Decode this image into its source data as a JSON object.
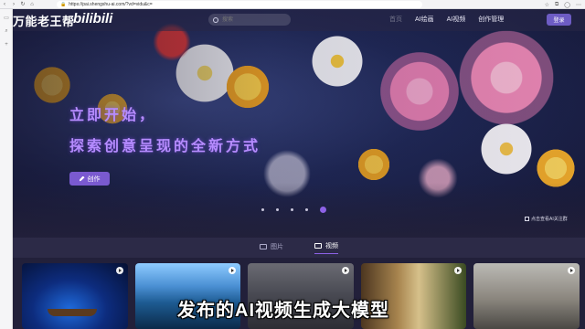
{
  "browser": {
    "url": "https://pai.shengshu-ai.com/?vd=vidu&c=",
    "nav_icons": [
      "back-icon",
      "forward-icon",
      "refresh-icon"
    ]
  },
  "header": {
    "brand_text": "万能老王帮",
    "brand_logo": "bilibili",
    "search_placeholder": "搜索",
    "nav": [
      "首页",
      "AI绘画",
      "AI视频",
      "创作管理"
    ],
    "login_label": "登录"
  },
  "hero": {
    "title": "立即开始，",
    "subtitle": "探索创意呈现的全新方式",
    "create_label": "创作",
    "slide_count": 5,
    "active_slide": 5,
    "corner_note": "点击查看AI关注群"
  },
  "tabs": [
    {
      "label": "图片",
      "active": false
    },
    {
      "label": "视频",
      "active": true
    }
  ],
  "cards": [
    {
      "icon": "play-icon"
    },
    {
      "icon": "play-icon"
    },
    {
      "icon": "play-icon"
    },
    {
      "icon": "play-icon"
    },
    {
      "icon": "play-icon"
    }
  ],
  "caption": "发布的AI视频生成大模型",
  "colors": {
    "accent": "#8d62e6",
    "login": "#6d5cc4",
    "hero_text": "#b68cff"
  }
}
